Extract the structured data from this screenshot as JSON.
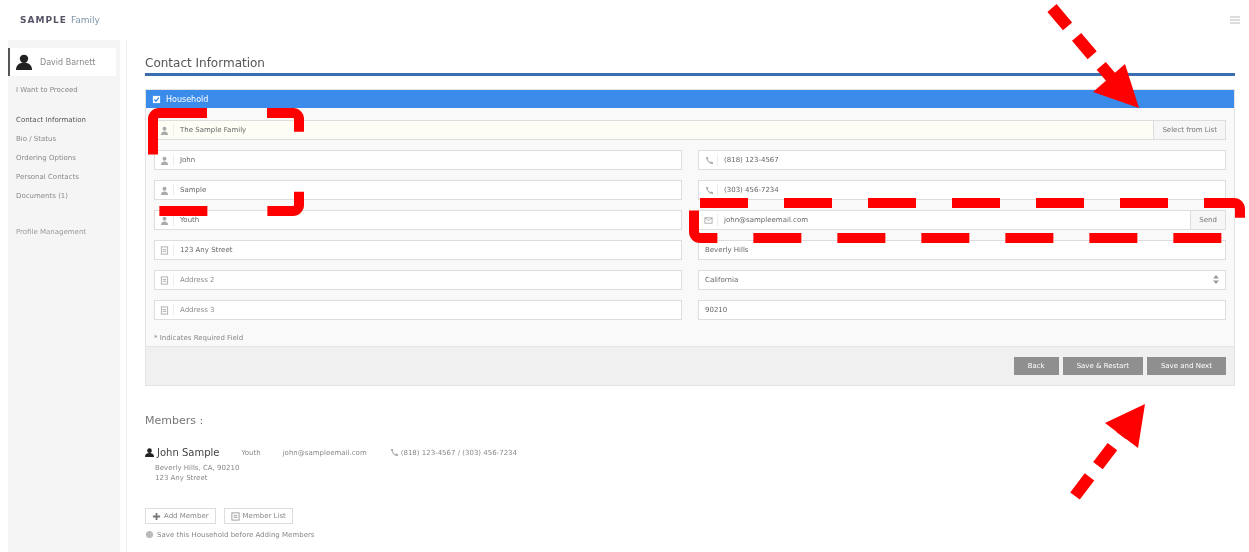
{
  "header": {
    "logo_main": "SAMPLE",
    "logo_sub": "Family"
  },
  "sidebar": {
    "user": "David Barnett",
    "link": "I Want to Proceed",
    "items": [
      {
        "label": "Contact Information",
        "selected": true
      },
      {
        "label": "Bio / Status",
        "selected": false
      },
      {
        "label": "Ordering Options",
        "selected": false
      },
      {
        "label": "Personal Contacts",
        "selected": false
      },
      {
        "label": "Documents (1)",
        "selected": false
      }
    ],
    "extra": "Profile Management"
  },
  "page_title": "Contact Information",
  "panel": {
    "header": "Household",
    "family": {
      "value": "The Sample Family",
      "button": "Select from List"
    },
    "left": [
      {
        "kind": "person",
        "value": "John"
      },
      {
        "kind": "person",
        "value": "Sample"
      },
      {
        "kind": "person",
        "value": "Youth"
      },
      {
        "kind": "address",
        "value": "123 Any Street"
      },
      {
        "kind": "address",
        "placeholder": "Address 2"
      },
      {
        "kind": "address",
        "placeholder": "Address 3"
      }
    ],
    "right": [
      {
        "kind": "phone",
        "value": "(818) 123-4567"
      },
      {
        "kind": "phone",
        "value": "(303) 456-7234"
      },
      {
        "kind": "email",
        "value": "john@sampleemail.com",
        "button": "Send"
      },
      {
        "kind": "plain",
        "value": "Beverly Hills"
      },
      {
        "kind": "select",
        "value": "California"
      },
      {
        "kind": "plain",
        "value": "90210"
      }
    ],
    "footnote": "* Indicates Required Field",
    "buttons": [
      "Back",
      "Save & Restart",
      "Save and Next"
    ]
  },
  "members": {
    "title": "Members :",
    "list": [
      {
        "name": "John Sample",
        "role": "Youth",
        "email": "john@sampleemail.com",
        "phones": "(818) 123-4567 / (303) 456-7234",
        "city": "Beverly Hills, CA, 90210",
        "street": "123 Any Street"
      }
    ],
    "buttons": [
      {
        "kind": "add",
        "label": "Add Member"
      },
      {
        "kind": "list",
        "label": "Member List"
      }
    ],
    "note": "Save this Household before Adding Members"
  }
}
